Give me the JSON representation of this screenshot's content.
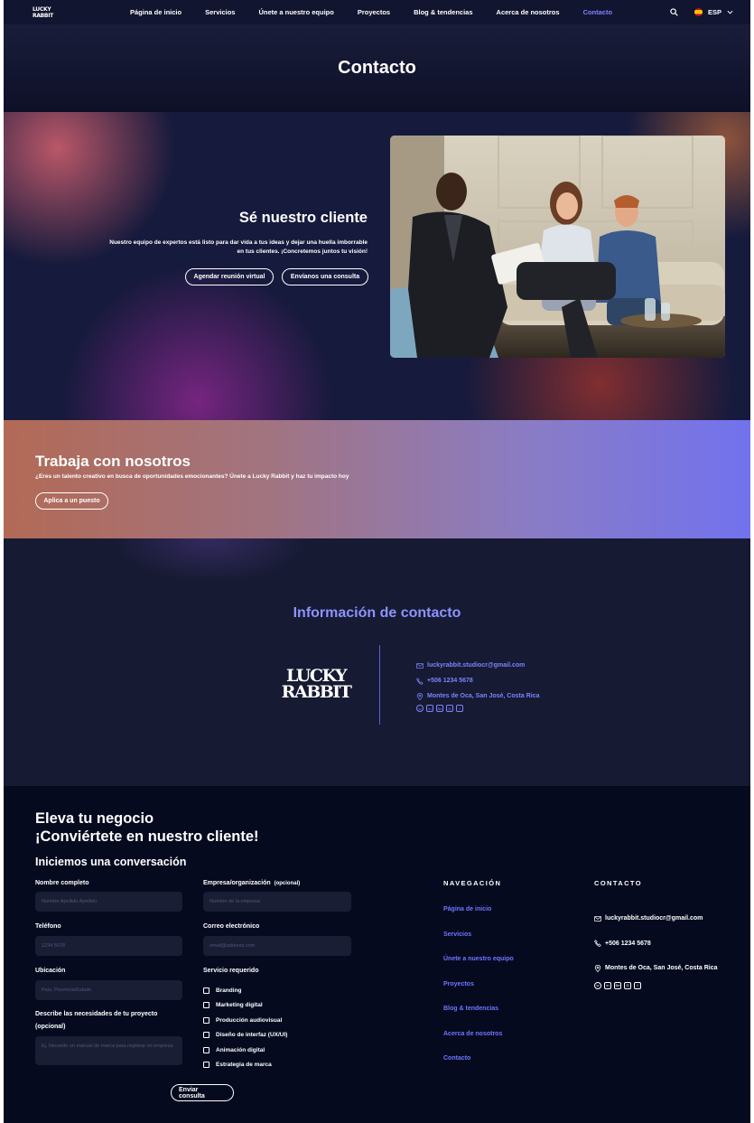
{
  "nav": {
    "logo_lines": [
      "LUCKY",
      "RABBIT"
    ],
    "links": [
      "Página de inicio",
      "Servicios",
      "Únete a nuestro equipo",
      "Proyectos",
      "Blog & tendencias",
      "Acerca de nosotros",
      "Contacto"
    ],
    "active": "Contacto",
    "language": "ESP",
    "search_icon": "search-icon",
    "accent_color": "#7d83ff"
  },
  "header": {
    "title": "Contacto"
  },
  "hero": {
    "title": "Sé nuestro cliente",
    "text": "Nuestro equipo de expertos está listo para dar vida a tus ideas y dejar una huella imborrable en tus clientes. ¡Concretemos juntos tu visión!",
    "button_meeting": "Agendar reunión virtual",
    "button_inquiry": "Envíanos una consulta"
  },
  "work": {
    "title": "Trabaja con nosotros",
    "text": "¿Eres un talento creativo en busca de oportunidades emocionantes? Únete a Lucky Rabbit y haz tu impacto hoy",
    "button": "Aplica a un puesto"
  },
  "info": {
    "title": "Información de contacto",
    "logo_lines": [
      "LUCKY",
      "RABBIT"
    ],
    "email": "luckyrabbit.studiocr@gmail.com",
    "phone": "+506 1234 5678",
    "address": "Montes de Oca, San José, Costa Rica",
    "social_icons": [
      "whatsapp-icon",
      "linkedin-icon",
      "behance-icon",
      "instagram-icon",
      "facebook-icon"
    ]
  },
  "footer": {
    "cta_line1": "Eleva tu negocio",
    "cta_line2": "¡Conviértete en nuestro cliente!",
    "form_title": "Iniciemos una conversación",
    "form": {
      "name_label": "Nombre completo",
      "name_placeholder": "Nombre Apellido Apellido",
      "company_label": "Empresa/organización",
      "company_optional": "(opcional)",
      "company_placeholder": "Nombre de la empresa",
      "phone_label": "Teléfono",
      "phone_placeholder": "1234 5678",
      "email_label": "Correo electrónico",
      "email_placeholder": "email@address.com",
      "location_label": "Ubicación",
      "location_placeholder": "País, Provincia/Estado",
      "service_label": "Servicio requerido",
      "services": [
        "Branding",
        "Marketing digital",
        "Producción audiovisual",
        "Diseño de interfaz (UX/UI)",
        "Animación digital",
        "Estrategia de marca"
      ],
      "describe_label": "Describe las necesidades de tu proyecto",
      "describe_optional": "(opcional)",
      "describe_placeholder": "Ej. Necesito un manual de marca para registrar mi empresa",
      "submit": "Enviar consulta"
    },
    "nav_title": "NAVEGACIÓN",
    "nav_links": [
      "Página de inicio",
      "Servicios",
      "Únete a nuestro equipo",
      "Proyectos",
      "Blog & tendencias",
      "Acerca de nosotros",
      "Contacto"
    ],
    "contact_title": "CONTACTO",
    "email": "luckyrabbit.studiocr@gmail.com",
    "phone": "+506 1234 5678",
    "address": "Montes de Oca, San José, Costa Rica"
  }
}
